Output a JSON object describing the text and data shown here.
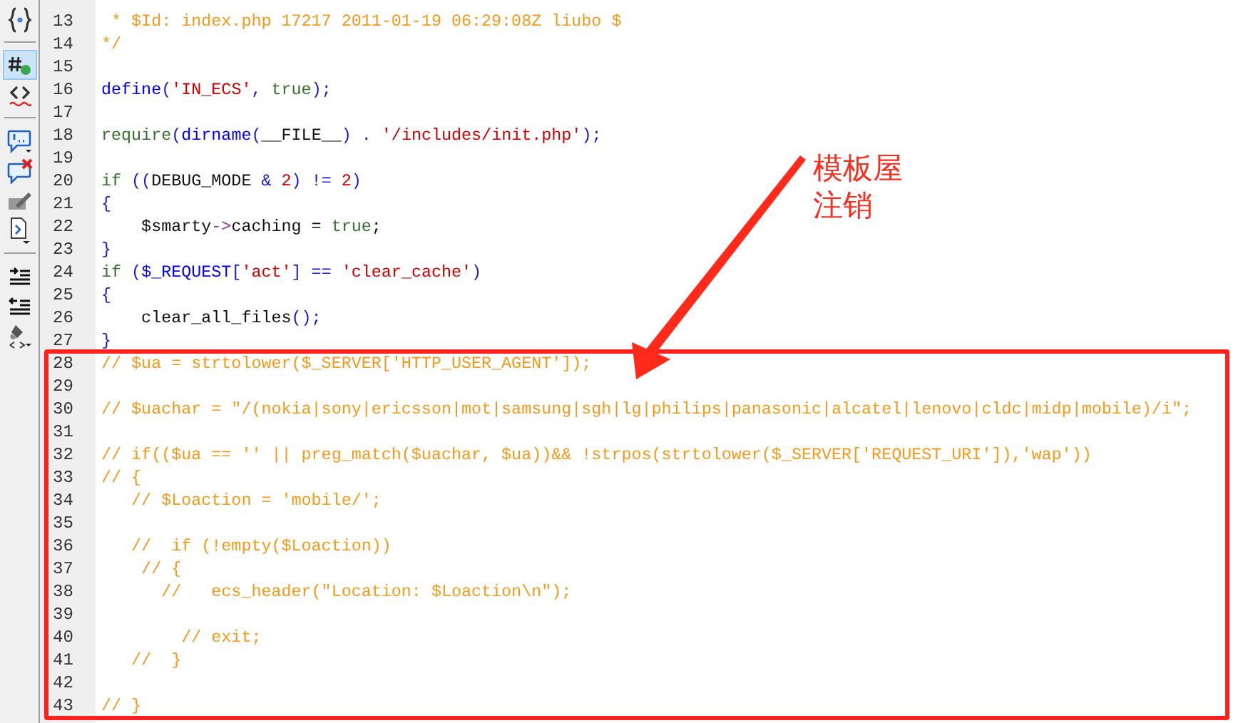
{
  "toolbar": [
    {
      "selected": false
    },
    {
      "selected": true
    },
    {
      "selected": false
    },
    {
      "selected": false
    },
    {
      "selected": false
    },
    {
      "selected": false
    },
    {
      "selected": false
    },
    {
      "selected": false
    },
    {
      "selected": false
    },
    {
      "selected": false
    }
  ],
  "code_lines": [
    {
      "number": "13",
      "tokens": [
        {
          "kind": "comment",
          "text": " * $Id: index.php 17217 2011-01-19 06:29:08Z liubo $"
        }
      ]
    },
    {
      "number": "14",
      "tokens": [
        {
          "kind": "comment",
          "text": "*/"
        }
      ]
    },
    {
      "number": "15"
    },
    {
      "number": "16",
      "tokens": [
        {
          "kind": "builtin",
          "text": "define"
        },
        {
          "kind": "punct",
          "text": "("
        },
        {
          "kind": "string",
          "text": "'IN_ECS'"
        },
        {
          "kind": "punct",
          "text": ", "
        },
        {
          "kind": "keyword",
          "text": "true"
        },
        {
          "kind": "punct",
          "text": ");"
        }
      ]
    },
    {
      "number": "17"
    },
    {
      "number": "18",
      "tokens": [
        {
          "kind": "keyword",
          "text": "require"
        },
        {
          "kind": "punct",
          "text": "("
        },
        {
          "kind": "builtin",
          "text": "dirname"
        },
        {
          "kind": "punct",
          "text": "("
        },
        {
          "kind": "plain",
          "text": "__FILE__"
        },
        {
          "kind": "punct",
          "text": ") . "
        },
        {
          "kind": "string",
          "text": "'/includes/init.php'"
        },
        {
          "kind": "punct",
          "text": ");"
        }
      ]
    },
    {
      "number": "19"
    },
    {
      "number": "20",
      "tokens": [
        {
          "kind": "keyword",
          "text": "if"
        },
        {
          "kind": "punct",
          "text": " (("
        },
        {
          "kind": "plain",
          "text": "DEBUG_MODE"
        },
        {
          "kind": "punct",
          "text": " & "
        },
        {
          "kind": "number",
          "text": "2"
        },
        {
          "kind": "punct",
          "text": ") != "
        },
        {
          "kind": "number",
          "text": "2"
        },
        {
          "kind": "punct",
          "text": ")"
        }
      ]
    },
    {
      "number": "21",
      "tokens": [
        {
          "kind": "punct",
          "text": "{"
        }
      ]
    },
    {
      "number": "22",
      "tokens": [
        {
          "kind": "plain",
          "text": "    $smarty"
        },
        {
          "kind": "operator",
          "text": "->"
        },
        {
          "kind": "plain",
          "text": "caching = "
        },
        {
          "kind": "keyword",
          "text": "true"
        },
        {
          "kind": "plain",
          "text": ";"
        }
      ]
    },
    {
      "number": "23",
      "tokens": [
        {
          "kind": "punct",
          "text": "}"
        }
      ]
    },
    {
      "number": "24",
      "tokens": [
        {
          "kind": "keyword",
          "text": "if"
        },
        {
          "kind": "punct",
          "text": " ("
        },
        {
          "kind": "builtin",
          "text": "$_REQUEST"
        },
        {
          "kind": "punct",
          "text": "["
        },
        {
          "kind": "string",
          "text": "'act'"
        },
        {
          "kind": "punct",
          "text": "] == "
        },
        {
          "kind": "string",
          "text": "'clear_cache'"
        },
        {
          "kind": "punct",
          "text": ")"
        }
      ]
    },
    {
      "number": "25",
      "tokens": [
        {
          "kind": "punct",
          "text": "{"
        }
      ]
    },
    {
      "number": "26",
      "tokens": [
        {
          "kind": "plain",
          "text": "    clear_all_files"
        },
        {
          "kind": "punct",
          "text": "();"
        }
      ]
    },
    {
      "number": "27",
      "tokens": [
        {
          "kind": "punct",
          "text": "}"
        }
      ]
    },
    {
      "number": "28",
      "tokens": [
        {
          "kind": "comment",
          "text": "// $ua = strtolower($_SERVER['HTTP_USER_AGENT']);"
        }
      ]
    },
    {
      "number": "29"
    },
    {
      "number": "30",
      "tokens": [
        {
          "kind": "comment",
          "text": "// $uachar = \"/(nokia|sony|ericsson|mot|samsung|sgh|lg|philips|panasonic|alcatel|lenovo|cldc|midp|mobile)/i\";"
        }
      ]
    },
    {
      "number": "31"
    },
    {
      "number": "32",
      "tokens": [
        {
          "kind": "comment",
          "text": "// if(($ua == '' || preg_match($uachar, $ua))&& !strpos(strtolower($_SERVER['REQUEST_URI']),'wap'))"
        }
      ]
    },
    {
      "number": "33",
      "tokens": [
        {
          "kind": "comment",
          "text": "// {"
        }
      ]
    },
    {
      "number": "34",
      "tokens": [
        {
          "kind": "comment",
          "text": "   // $Loaction = 'mobile/';"
        }
      ]
    },
    {
      "number": "35"
    },
    {
      "number": "36",
      "tokens": [
        {
          "kind": "comment",
          "text": "   //  if (!empty($Loaction))"
        }
      ]
    },
    {
      "number": "37",
      "tokens": [
        {
          "kind": "comment",
          "text": "    // {"
        }
      ]
    },
    {
      "number": "38",
      "tokens": [
        {
          "kind": "comment",
          "text": "      //   ecs_header(\"Location: $Loaction\\n\");"
        }
      ]
    },
    {
      "number": "39"
    },
    {
      "number": "40",
      "tokens": [
        {
          "kind": "comment",
          "text": "        // exit;"
        }
      ]
    },
    {
      "number": "41",
      "tokens": [
        {
          "kind": "comment",
          "text": "   //  }"
        }
      ]
    },
    {
      "number": "42"
    },
    {
      "number": "43",
      "tokens": [
        {
          "kind": "comment",
          "text": "// }"
        }
      ]
    }
  ],
  "annotation": {
    "lines": [
      "模板屋",
      "注销"
    ]
  }
}
